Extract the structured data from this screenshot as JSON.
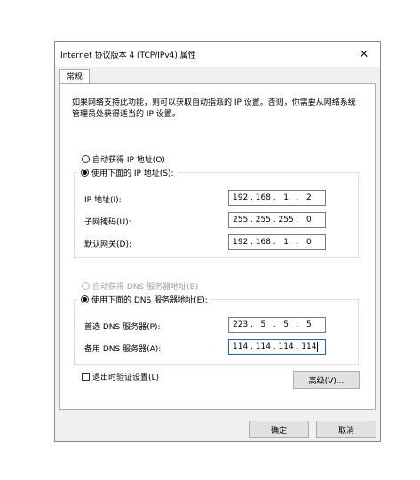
{
  "window": {
    "title": "Internet 协议版本 4 (TCP/IPv4) 属性",
    "close_glyph": "✕"
  },
  "tabs": [
    {
      "label": "常规",
      "selected": true
    }
  ],
  "description": "如果网络支持此功能，则可以获取自动指派的 IP 设置。否则，你需要从网络系统管理员处获得适当的 IP 设置。",
  "ip_section": {
    "auto_option": {
      "label": "自动获得 IP 地址(O)",
      "selected": false
    },
    "manual_option": {
      "label": "使用下面的 IP 地址(S):",
      "selected": true
    },
    "fields": [
      {
        "label": "IP 地址(I):",
        "value": "192 . 168 .   1   .   2"
      },
      {
        "label": "子网掩码(U):",
        "value": "255 . 255 . 255 .   0"
      },
      {
        "label": "默认网关(D):",
        "value": "192 . 168 .   1   .   0"
      }
    ]
  },
  "dns_section": {
    "auto_option": {
      "label": "自动获得 DNS 服务器地址(B)",
      "selected": false,
      "enabled": false
    },
    "manual_option": {
      "label": "使用下面的 DNS 服务器地址(E):",
      "selected": true
    },
    "fields": [
      {
        "label": "首选 DNS 服务器(P):",
        "value": "223 .   5   .   5   .   5"
      },
      {
        "label": "备用 DNS 服务器(A):",
        "value": "114 . 114 . 114 . 114"
      }
    ]
  },
  "validate_on_exit": {
    "label": "退出时验证设置(L)",
    "checked": false
  },
  "buttons": {
    "advanced": "高级(V)...",
    "ok": "确定",
    "cancel": "取消"
  },
  "colors": {
    "dialog_bg": "#f0f0f0",
    "panel_bg": "#ffffff",
    "focus_border": "#1e66c8",
    "disabled_text": "#a0a0a0"
  }
}
